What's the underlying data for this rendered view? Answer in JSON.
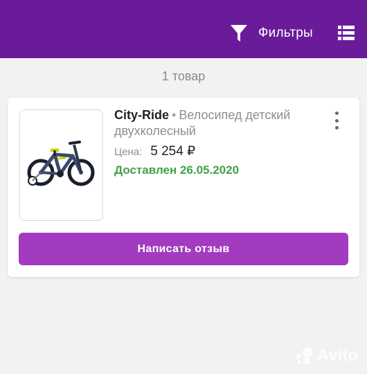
{
  "header": {
    "filter_icon": "funnel-icon",
    "filter_label": "Фильтры",
    "menu_icon": "list-view-icon",
    "bg_color": "#6a1b9a"
  },
  "list": {
    "count_label": "1 товар"
  },
  "item": {
    "image_alt": "bicycle-image",
    "brand": "City-Ride",
    "separator": "•",
    "title": "Велосипед детский двухколесный",
    "price_label": "Цена:",
    "price": "5 254 ₽",
    "status": "Доставлен 26.05.2020",
    "status_color": "#43a047",
    "more_icon": "more-vertical-icon",
    "review_button": "Написать отзыв",
    "review_button_color": "#a23bbf"
  },
  "watermark": {
    "text": "Avito"
  }
}
